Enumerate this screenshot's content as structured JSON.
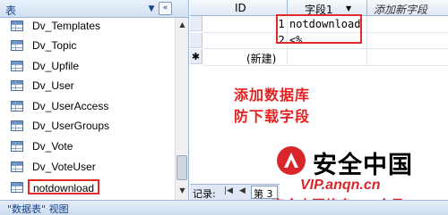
{
  "nav": {
    "title": "表",
    "chevron_icon": "chevron-double-down",
    "collapse_icon": "double-left-arrow",
    "tables": [
      "Dv_Templates",
      "Dv_Topic",
      "Dv_Upfile",
      "Dv_User",
      "Dv_UserAccess",
      "Dv_UserGroups",
      "Dv_Vote",
      "Dv_VoteUser",
      "notdownload"
    ],
    "selected_table": "notdownload"
  },
  "sheet": {
    "columns": {
      "id": "ID",
      "field1": "字段1",
      "add_field": "添加新字段"
    },
    "rows": [
      {
        "id": "1",
        "field1": "notdownload"
      },
      {
        "id": "2",
        "field1": "<%"
      }
    ],
    "new_row_marker": "✱",
    "new_row_label": "(新建)"
  },
  "annotation": {
    "line1": "添加数据库",
    "line2": "防下载字段"
  },
  "record_nav": {
    "label": "记录:",
    "first_icon": "first-record",
    "prev_icon": "previous-record",
    "current": "第 3"
  },
  "watermark": {
    "brand": "安全中国",
    "url": "VIP.anqn.cn",
    "slogan": "安全中国终身VIP会员",
    "accent_color": "#d9262a"
  },
  "status_bar": {
    "view_label": "\"数据表\" 视图"
  }
}
